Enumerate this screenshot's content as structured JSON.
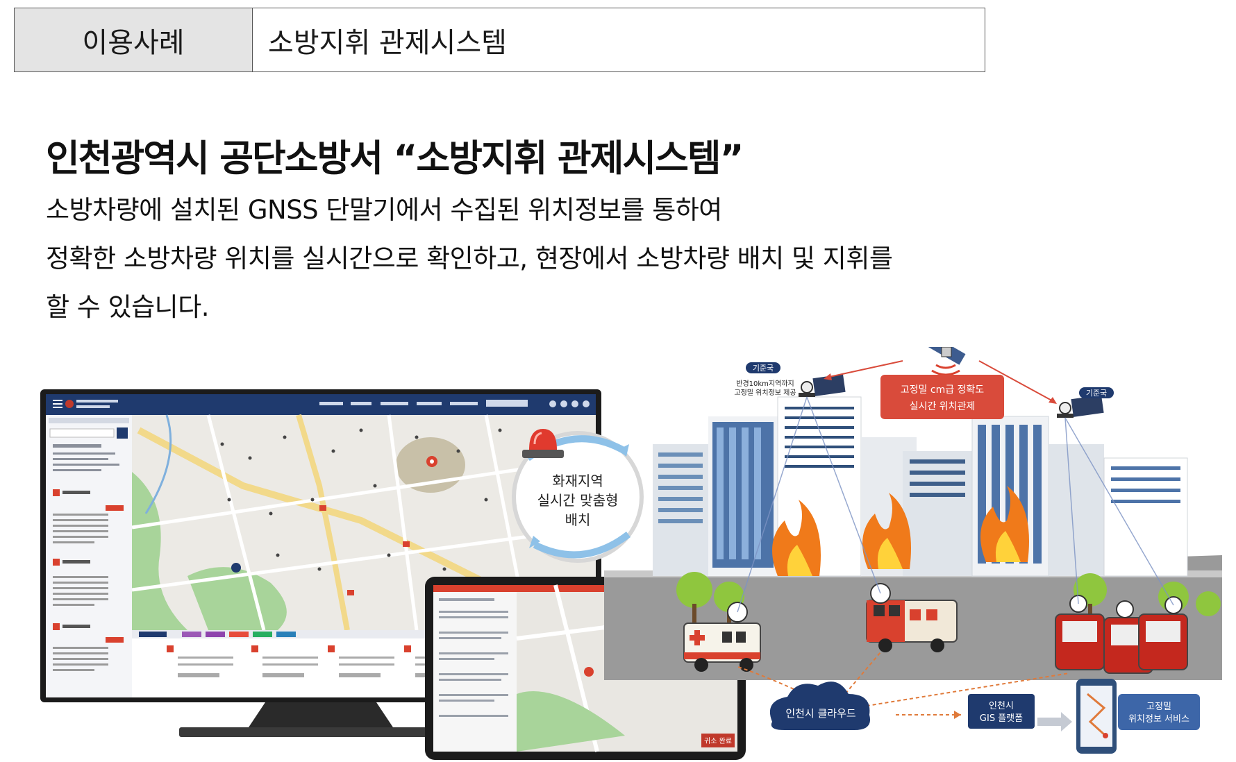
{
  "case_table": {
    "label": "이용사례",
    "value": "소방지휘 관제시스템"
  },
  "headline": "인천광역시 공단소방서 “소방지휘 관제시스템”",
  "description": {
    "lines": [
      "소방차량에 설치된 GNSS 단말기에서 수집된 위치정보를 통하여",
      "정확한 소방차량 위치를 실시간으로 확인하고, 현장에서 소방차량 배치 및 지휘를",
      "할 수 있습니다."
    ]
  },
  "illustration": {
    "dispatch_label": [
      "화재지역",
      "실시간 맞춤형",
      "배치"
    ],
    "base_station_label": "기준국",
    "base_station_note": [
      "반경10km지역까지",
      "고정밀 위치정보 제공"
    ],
    "accuracy_banner": [
      "고정밀 cm급 정확도",
      "실시간 위치관제"
    ],
    "cloud_label": "인천시 클라우드",
    "gis_label": [
      "인천시",
      "GIS 플랫폼"
    ],
    "service_label": [
      "고정밀",
      "위치정보 서비스"
    ],
    "tablet_button": "귀소 완료",
    "colors": {
      "navy": "#1f3a6e",
      "red": "#d9412e",
      "banner_red": "#d94b3b",
      "accent_orange": "#e07a3a",
      "map_green": "#9ccc8a",
      "road_gray": "#9a9a9a"
    }
  }
}
